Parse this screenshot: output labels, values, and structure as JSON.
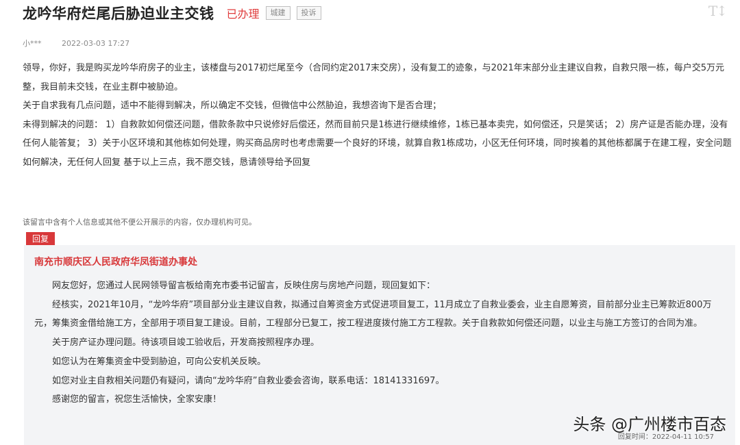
{
  "header": {
    "title": "龙吟华府烂尾后胁迫业主交钱",
    "status": "已办理",
    "tags": [
      "城建",
      "投诉"
    ],
    "font_toggle": "T↕"
  },
  "meta": {
    "author": "小***",
    "datetime": "2022-03-03 17:27"
  },
  "message": {
    "paragraphs": [
      "领导，你好，我是购买龙吟华府房子的业主，该楼盘与2017初烂尾至今（合同约定2017末交房），没有复工的迹象，与2021年末部分业主建议自救，自救只限一栋，每户交5万元整，我目前未交钱，在业主群中被胁迫。",
      "关于自求我有几点问题，适中不能得到解决，所以确定不交钱，但微信中公然胁迫，我想咨询下是否合理；",
      "未得到解决的问题： 1）自救款如何偿还问题，借款条款中只说修好后偿还，然而目前只是1栋进行继续维修，1栋已基本卖完，如何偿还，只是笑话； 2）房产证是否能办理，没有任何人能答复； 3）关于小区环境和其他栋如何处理，购买商品房时也考虑需要一个良好的环境，就算自救1栋成功，小区无任何环境，同时挨着的其他栋都属于在建工程，安全问题如何解决，无任何人回复 基于以上三点，我不愿交钱，恳请领导给予回复"
    ]
  },
  "privacy_notice": "该留言中含有个人信息或其他不便公开展示的内容，仅办理机构可见。",
  "reply": {
    "badge": "回复",
    "org": "南充市顺庆区人民政府华凤街道办事处",
    "paragraphs": [
      "网友您好，您通过人民网领导留言板给南充市委书记留言，反映住房与房地产问题，现回复如下：",
      "经核实，2021年10月，“龙吟华府”项目部分业主建议自救，拟通过自筹资金方式促进项目复工，11月成立了自救业委会，业主自愿筹资，目前部分业主已筹款近800万元，筹集资金借给施工方，全部用于项目复工建设。目前，工程部分已复工，按工程进度拨付施工方工程款。关于自救款如何偿还问题，以业主与施工方签订的合同为准。",
      "关于房产证办理问题。待该项目竣工验收后，开发商按照程序办理。",
      "如您认为在筹集资金中受到胁迫，可向公安机关反映。",
      "如您对业主自救相关问题仍有疑问，请向“龙吟华府”自救业委会咨询，联系电话：18141331697。",
      "感谢您的留言，祝您生活愉快，全家安康！"
    ],
    "time": "回复时间：2022-04-11 10:57"
  },
  "watermark": "头条 @广州楼市百态"
}
